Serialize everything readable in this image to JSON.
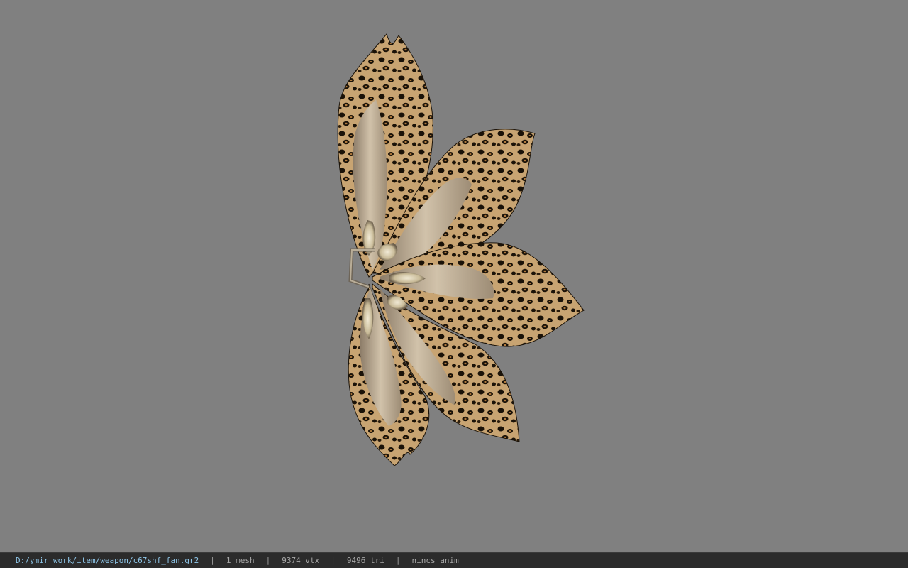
{
  "viewport": {
    "background_color": "#808080",
    "model_name": "c67shf_fan",
    "model_icon": "fan-model-icon",
    "pattern_colors": {
      "base": "#c8a472",
      "spots": "#1a1208",
      "inner": "#b7a48a",
      "frame": "#6e6558"
    }
  },
  "statusbar": {
    "path": "D:/ymir work/item/weapon/c67shf_fan.gr2",
    "separator": "|",
    "mesh": "1 mesh",
    "vertices": "9374 vtx",
    "triangles": "9496 tri",
    "animation": "nincs anim",
    "path_color": "#8fc7ea"
  }
}
